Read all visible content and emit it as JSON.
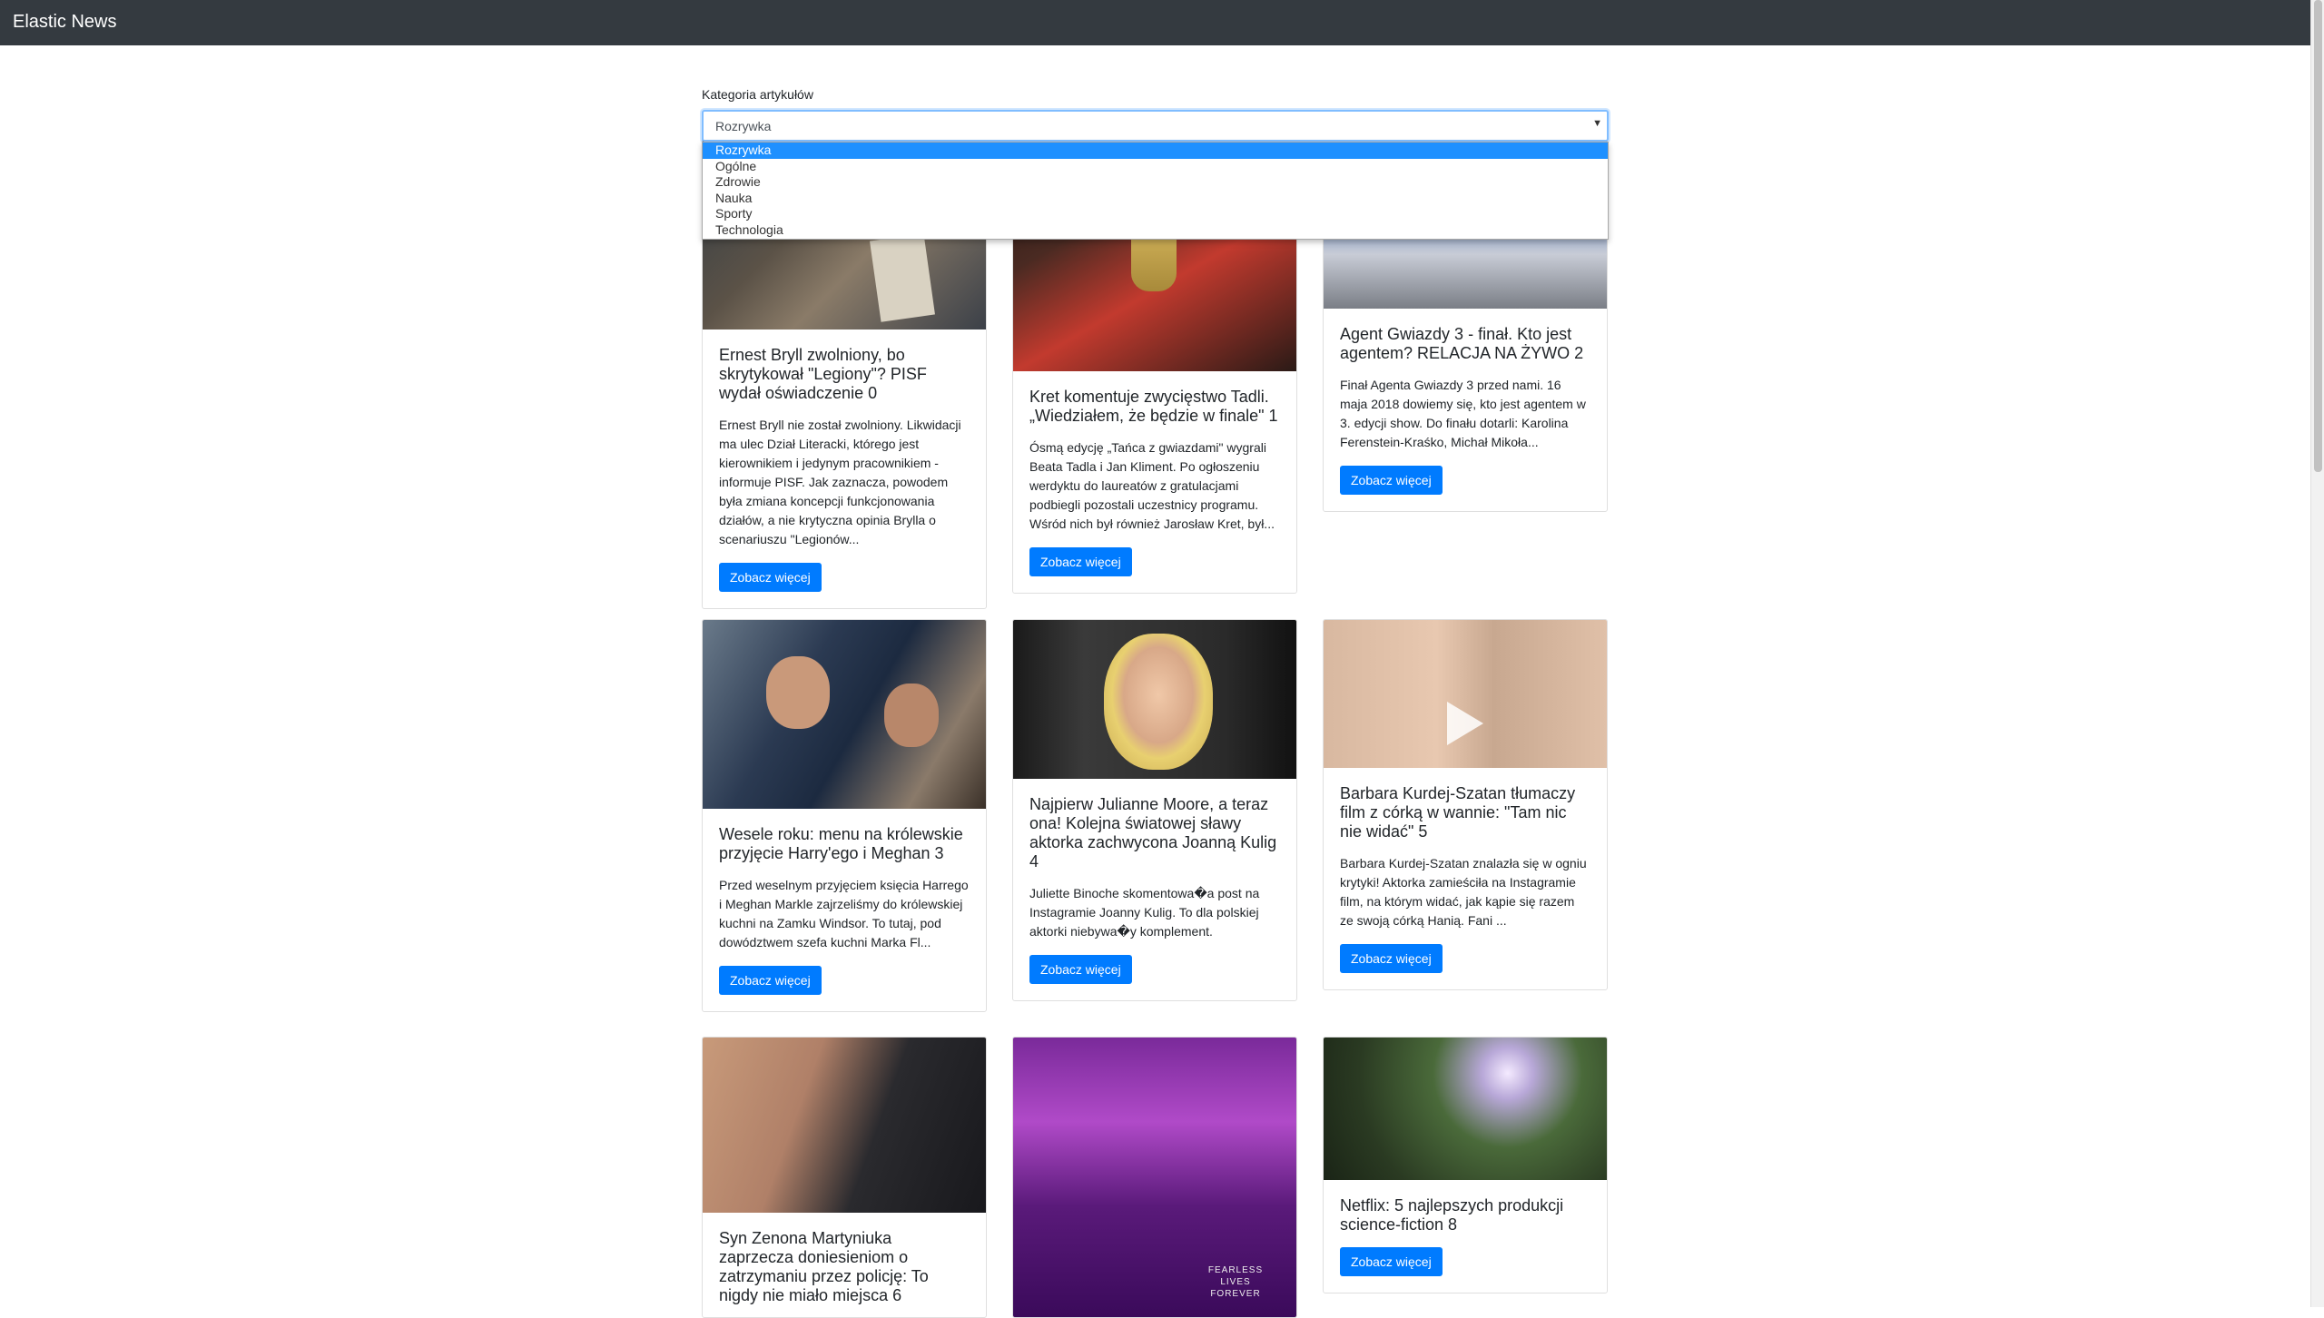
{
  "navbar": {
    "brand": "Elastic News"
  },
  "filter": {
    "label": "Kategoria artykułów",
    "selected": "Rozrywka",
    "options": [
      "Rozrywka",
      "Ogólne",
      "Zdrowie",
      "Nauka",
      "Sporty",
      "Technologia"
    ]
  },
  "button_label": "Zobacz więcej",
  "articles": [
    {
      "title": "Ernest Bryll zwolniony, bo skrytykował \"Legiony\"? PISF wydał oświadczenie 0",
      "text": "Ernest Bryll nie został zwolniony. Likwidacji ma ulec Dział Literacki, którego jest kierownikiem i jedynym pracownikiem - informuje PISF. Jak zaznacza, powodem była zmiana koncepcji funkcjonowania działów, a nie krytyczna opinia Brylla o scenariuszu \"Legionów...",
      "image": "photo-people-gallery"
    },
    {
      "title": "Kret komentuje zwycięstwo Tadli. „Wiedziałem, że będzie w finale\" 1",
      "text": "Ósmą edycję „Tańca z gwiazdami\" wygrali Beata Tadla i Jan Kliment. Po ogłoszeniu werdyktu do laureatów z gratulacjami podbiegli pozostali uczestnicy programu. Wśród nich był również Jarosław Kret, był...",
      "image": "photo-dance-trophy"
    },
    {
      "title": "Agent Gwiazdy 3 - finał. Kto jest agentem? RELACJA NA ŻYWO 2",
      "text": "Finał Agenta Gwiazdy 3 przed nami. 16 maja 2018 dowiemy się, kto jest agentem w 3. edycji show. Do finału dotarli: Karolina Ferenstein-Kraśko, Michał Mikoła...",
      "image": "photo-tv-studio"
    },
    {
      "title": "Wesele roku: menu na królewskie przyjęcie Harry'ego i Meghan 3",
      "text": "Przed weselnym przyjęciem księcia Harrego i Meghan Markle zajrzeliśmy do królewskiej kuchni na Zamku Windsor. To tutaj, pod dowództwem szefa kuchni Marka Fl...",
      "image": "photo-royal-couple"
    },
    {
      "title": "Najpierw Julianne Moore, a teraz ona! Kolejna światowej sławy aktorka zachwycona Joanną Kulig 4",
      "text": "Juliette Binoche skomentowa�a post na Instagramie Joanny Kulig. To dla polskiej aktorki niebywa�y komplement.",
      "image": "photo-actress-portrait"
    },
    {
      "title": "Barbara Kurdej-Szatan tłumaczy film z córką w wannie: \"Tam nic nie widać\" 5",
      "text": "Barbara Kurdej-Szatan znalazła się w ogniu krytyki! Aktorka zamieściła na Instagramie film, na którym widać, jak kąpie się razem ze swoją córką Hanią. Fani ...",
      "image": "photo-video-selfie"
    },
    {
      "title": "Syn Zenona Martyniuka zaprzecza doniesieniom o zatrzymaniu przez policję: To nigdy nie miało miejsca 6",
      "text": "",
      "image": "photo-man-selfie"
    },
    {
      "title": "",
      "text": "",
      "image": "photo-movie-poster",
      "poster_text": "FEARLESS LIVES FOREVER"
    },
    {
      "title": "Netflix: 5 najlepszych produkcji science-fiction 8",
      "text": "",
      "image": "photo-forest-light"
    }
  ]
}
